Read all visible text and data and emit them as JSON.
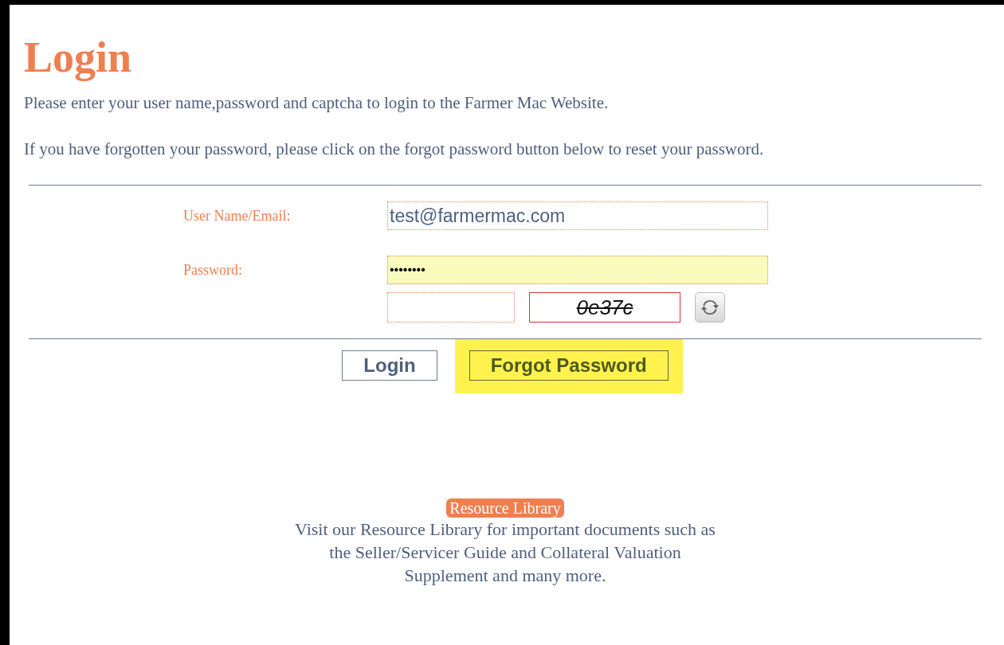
{
  "title": "Login",
  "intro": [
    "Please enter your user name,password and captcha to login to the Farmer Mac Website.",
    "If you have forgotten your password, please click on the forgot password button below to reset your password."
  ],
  "fields": [
    {
      "label": "User Name/Email:",
      "value": "test@farmermac.com",
      "highlighted": false
    },
    {
      "label": "Password:",
      "value": "••••••••",
      "highlighted": true
    }
  ],
  "captcha": {
    "code": "0e37c"
  },
  "buttons": [
    {
      "label": "Login",
      "highlighted": false
    },
    {
      "label": "Forgot Password",
      "highlighted": true
    }
  ],
  "resource": {
    "badge": "Resource Library",
    "lines": [
      "Visit our Resource Library for important documents such as",
      "the Seller/Servicer Guide and Collateral Valuation",
      "Supplement and many more."
    ]
  }
}
